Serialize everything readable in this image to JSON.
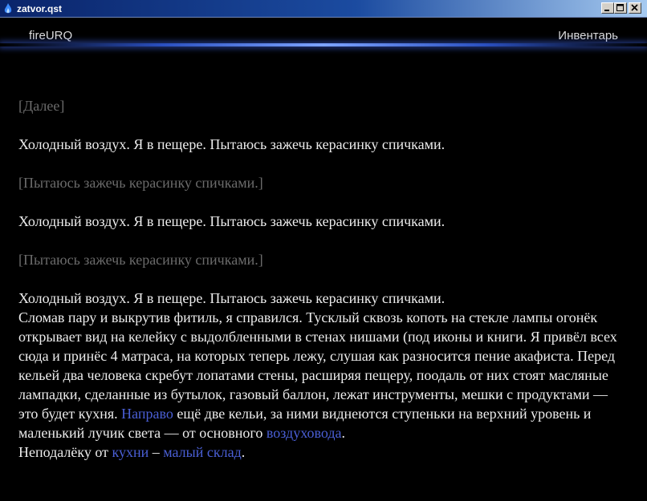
{
  "window": {
    "title": "zatvor.qst"
  },
  "header": {
    "brand": "fireURQ",
    "inventory": "Инвентарь"
  },
  "content": {
    "action_next": "[Далее]",
    "line_cold_1": "Холодный воздух. Я в пещере.  Пытаюсь зажечь керасинку спичками.",
    "action_light_1": "[Пытаюсь зажечь керасинку спичками.]",
    "line_cold_2": "Холодный воздух. Я в пещере.  Пытаюсь зажечь керасинку спичками.",
    "action_light_2": "[Пытаюсь зажечь керасинку спичками.]",
    "line_cold_3": "Холодный воздух. Я в пещере.  Пытаюсь зажечь керасинку спичками.",
    "paragraph_1": "Сломав пару и выкрутив фитиль, я справился. Тусклый сквозь копоть на стекле лампы огонёк открывает вид на келейку с выдолбленными в стенах нишами (под иконы и книги. Я привёл всех сюда и принёс 4 матраса, на которых теперь лежу, слушая как разносится пение акафиста. Перед кельей два человека скребут лопатами стены, расширяя пещеру, поодаль от них стоят масляные лампадки, сделанные из бутылок, газовый баллон, лежат инструменты, мешки с продуктами — это будет кухня.",
    "link_right": "Направо",
    "text_after_right": " ещё две кельи, за ними виднеются ступеньки на верхний уровень и маленький лучик света — от основного ",
    "link_air_duct": "воздуховода",
    "text_period": ".",
    "text_not_far": "Неподалёку от ",
    "link_kitchen": "кухни",
    "text_dash": "  – ",
    "link_small_storage": "малый склад",
    "text_end": "."
  },
  "colors": {
    "background": "#000000",
    "text": "#ececec",
    "action_text": "#6b6b6b",
    "link": "#4a5fd6",
    "accent_glow": "#2a4fbf"
  }
}
